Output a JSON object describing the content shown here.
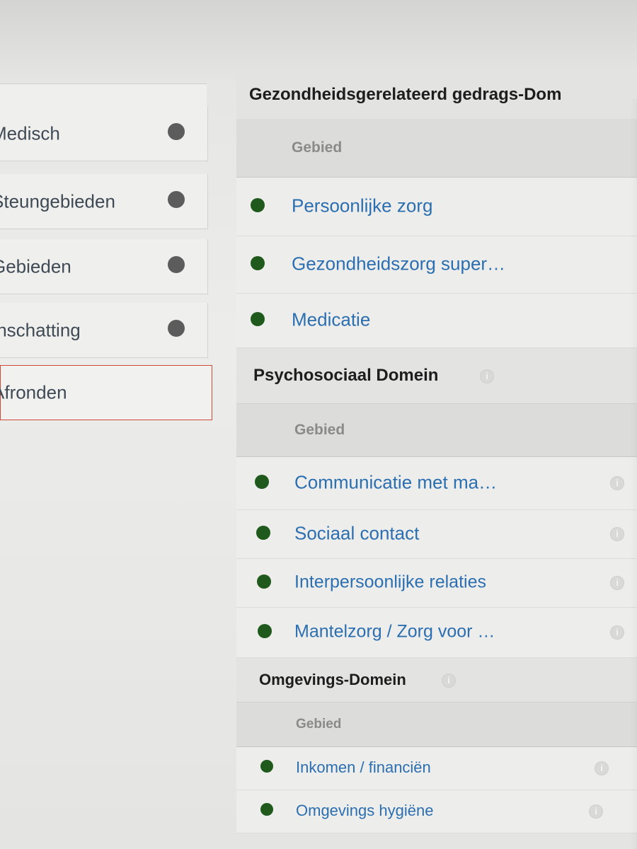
{
  "sidebar": {
    "items": [
      {
        "label": "Medisch",
        "status": "grey"
      },
      {
        "label": "Steungebieden",
        "status": "grey"
      },
      {
        "label": "Gebieden",
        "status": "grey"
      },
      {
        "label": "Inschatting",
        "status": "grey"
      },
      {
        "label": "Afronden",
        "status": "active"
      }
    ]
  },
  "main": {
    "domains": [
      {
        "title": "Gezondheidsgerelateerd gedrags-Dom",
        "column_header": "Gebied",
        "rows": [
          {
            "label": "Persoonlijke zorg",
            "status": "green"
          },
          {
            "label": "Gezondheidszorg super…",
            "status": "green"
          },
          {
            "label": "Medicatie",
            "status": "green"
          }
        ]
      },
      {
        "title": "Psychosociaal Domein",
        "column_header": "Gebied",
        "rows": [
          {
            "label": "Communicatie met ma…",
            "status": "green"
          },
          {
            "label": "Sociaal contact",
            "status": "green"
          },
          {
            "label": "Interpersoonlijke relaties",
            "status": "green"
          },
          {
            "label": "Mantelzorg / Zorg voor …",
            "status": "green"
          }
        ]
      },
      {
        "title": "Omgevings-Domein",
        "column_header": "Gebied",
        "rows": [
          {
            "label": "Inkomen / financiën",
            "status": "green"
          },
          {
            "label": "Omgevings hygiëne",
            "status": "green"
          }
        ]
      }
    ]
  },
  "colors": {
    "status_green": "#1f5a1c",
    "status_grey": "#5c5c5c",
    "link_blue": "#2c6fb0",
    "active_border": "#d04a3a"
  },
  "icons": {
    "status": "filled-circle-icon",
    "info": "info-circle-icon"
  }
}
